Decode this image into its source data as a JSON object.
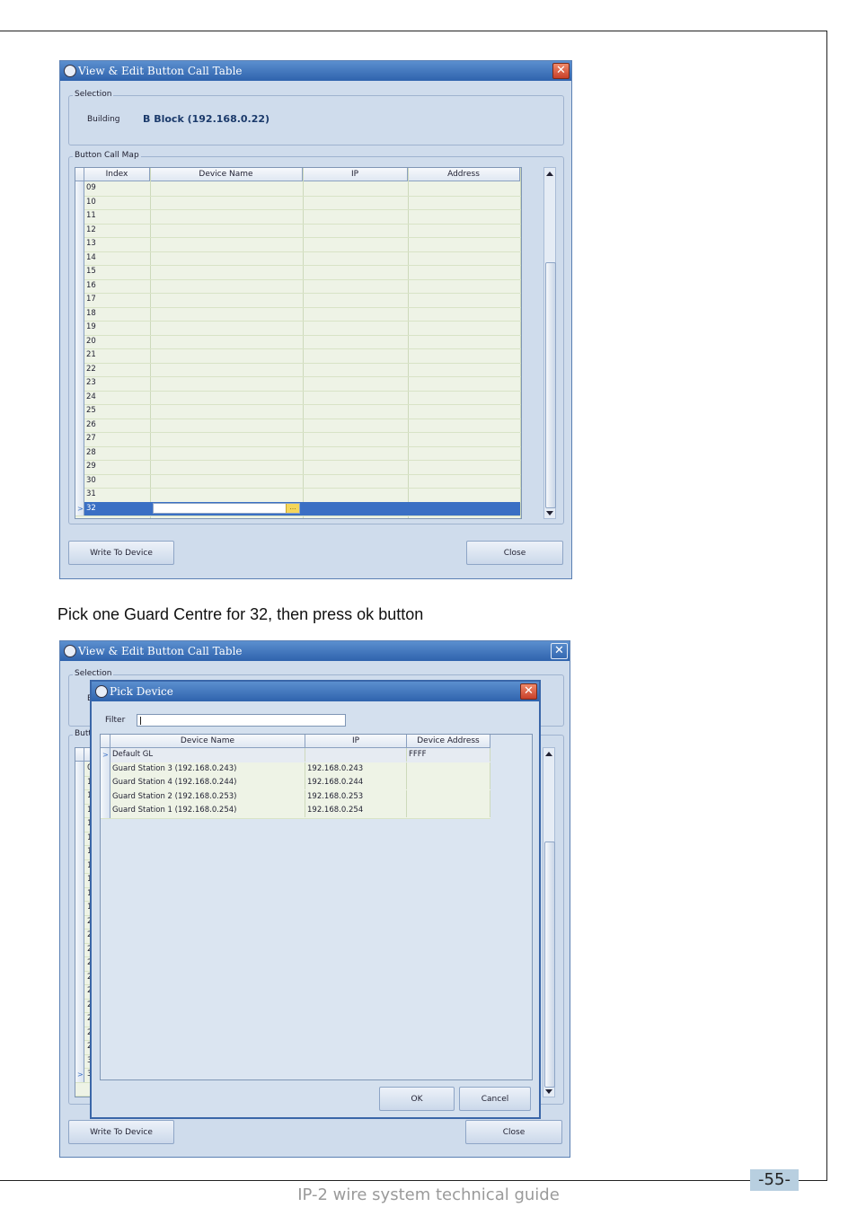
{
  "window1": {
    "title": "View & Edit Button Call Table",
    "selection_legend": "Selection",
    "building_label": "Building",
    "building_value": "B Block (192.168.0.22)",
    "map_legend": "Button Call Map",
    "columns": [
      "Index",
      "Device Name",
      "IP",
      "Address"
    ],
    "rows": [
      "09",
      "10",
      "11",
      "12",
      "13",
      "14",
      "15",
      "16",
      "17",
      "18",
      "19",
      "20",
      "21",
      "22",
      "23",
      "24",
      "25",
      "26",
      "27",
      "28",
      "29",
      "30",
      "31",
      "32"
    ],
    "selected_row": "32",
    "write_button": "Write To Device",
    "close_button": "Close"
  },
  "caption": "Pick one Guard Centre for 32, then press ok button",
  "window2": {
    "title": "View & Edit Button Call Table",
    "selection_legend": "Selection",
    "map_legend_partial": "Butt",
    "bg_building_partial": "B",
    "bg_first_index_partial": "0",
    "bg_index_digits": [
      "1",
      "1",
      "1",
      "1",
      "1",
      "1",
      "1",
      "1",
      "1",
      "1",
      "2",
      "2",
      "2",
      "2",
      "2",
      "2",
      "2",
      "2",
      "2",
      "2",
      "3",
      "3"
    ],
    "write_button": "Write To Device",
    "close_button": "Close"
  },
  "pick_dialog": {
    "title": "Pick Device",
    "filter_label": "Filter",
    "filter_value": "",
    "columns": [
      "Device Name",
      "IP",
      "Device Address"
    ],
    "rows": [
      {
        "name": "Default GL",
        "ip": "",
        "address": "FFFF"
      },
      {
        "name": "Guard Station 3 (192.168.0.243)",
        "ip": "192.168.0.243",
        "address": ""
      },
      {
        "name": "Guard Station 4 (192.168.0.244)",
        "ip": "192.168.0.244",
        "address": ""
      },
      {
        "name": "Guard Station 2 (192.168.0.253)",
        "ip": "192.168.0.253",
        "address": ""
      },
      {
        "name": "Guard Station 1 (192.168.0.254)",
        "ip": "192.168.0.254",
        "address": ""
      }
    ],
    "ok_button": "OK",
    "cancel_button": "Cancel"
  },
  "footer": {
    "text": "IP-2 wire system technical guide",
    "page": "-55-"
  },
  "colors": {
    "title_bar": "#2f63ad",
    "selected_row": "#3a6fc4",
    "close_red": "#c8402a",
    "page_badge": "#b8cfe0"
  }
}
